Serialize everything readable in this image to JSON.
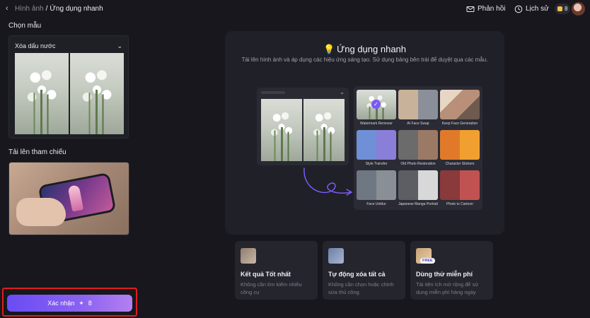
{
  "breadcrumb": {
    "parent": "Hình ảnh",
    "separator": "/",
    "current": "Ứng dụng nhanh"
  },
  "topbar": {
    "feedback": "Phản hồi",
    "history": "Lịch sử",
    "credits": "8"
  },
  "left": {
    "template_label": "Chọn mẫu",
    "template_select": "Xóa dấu nước",
    "reference_label": "Tải lên tham chiếu",
    "confirm_label": "Xác nhận",
    "confirm_cost": "8"
  },
  "panel": {
    "title": "Ứng dụng nhanh",
    "subtitle": "Tải lên hình ảnh và áp dụng các hiệu ứng sáng tạo. Sử dụng bảng bên trái để duyệt qua các mẫu.",
    "tiles": [
      "Watermark Remover",
      "AI Face Swap",
      "Keep Face Generation",
      "Style Transfer",
      "Old Photo Restoration",
      "Character Stickers",
      "Face Unblur",
      "Japanese Manga Portrait",
      "Photo to Cartoon"
    ]
  },
  "features": [
    {
      "title": "Kết quả Tốt nhất",
      "desc": "Không cần tìm kiếm nhiều công cụ"
    },
    {
      "title": "Tự động xóa tất cả",
      "desc": "Không cần chọn hoặc chỉnh sửa thủ công"
    },
    {
      "title": "Dùng thử miễn phí",
      "desc": "Tải tiện ích mở rộng để sử dụng miễn phí hàng ngày",
      "badge": "FREE"
    }
  ],
  "colors": {
    "accent": "#7a5af5",
    "highlight": "#e11d1d",
    "background": "#17171d"
  }
}
